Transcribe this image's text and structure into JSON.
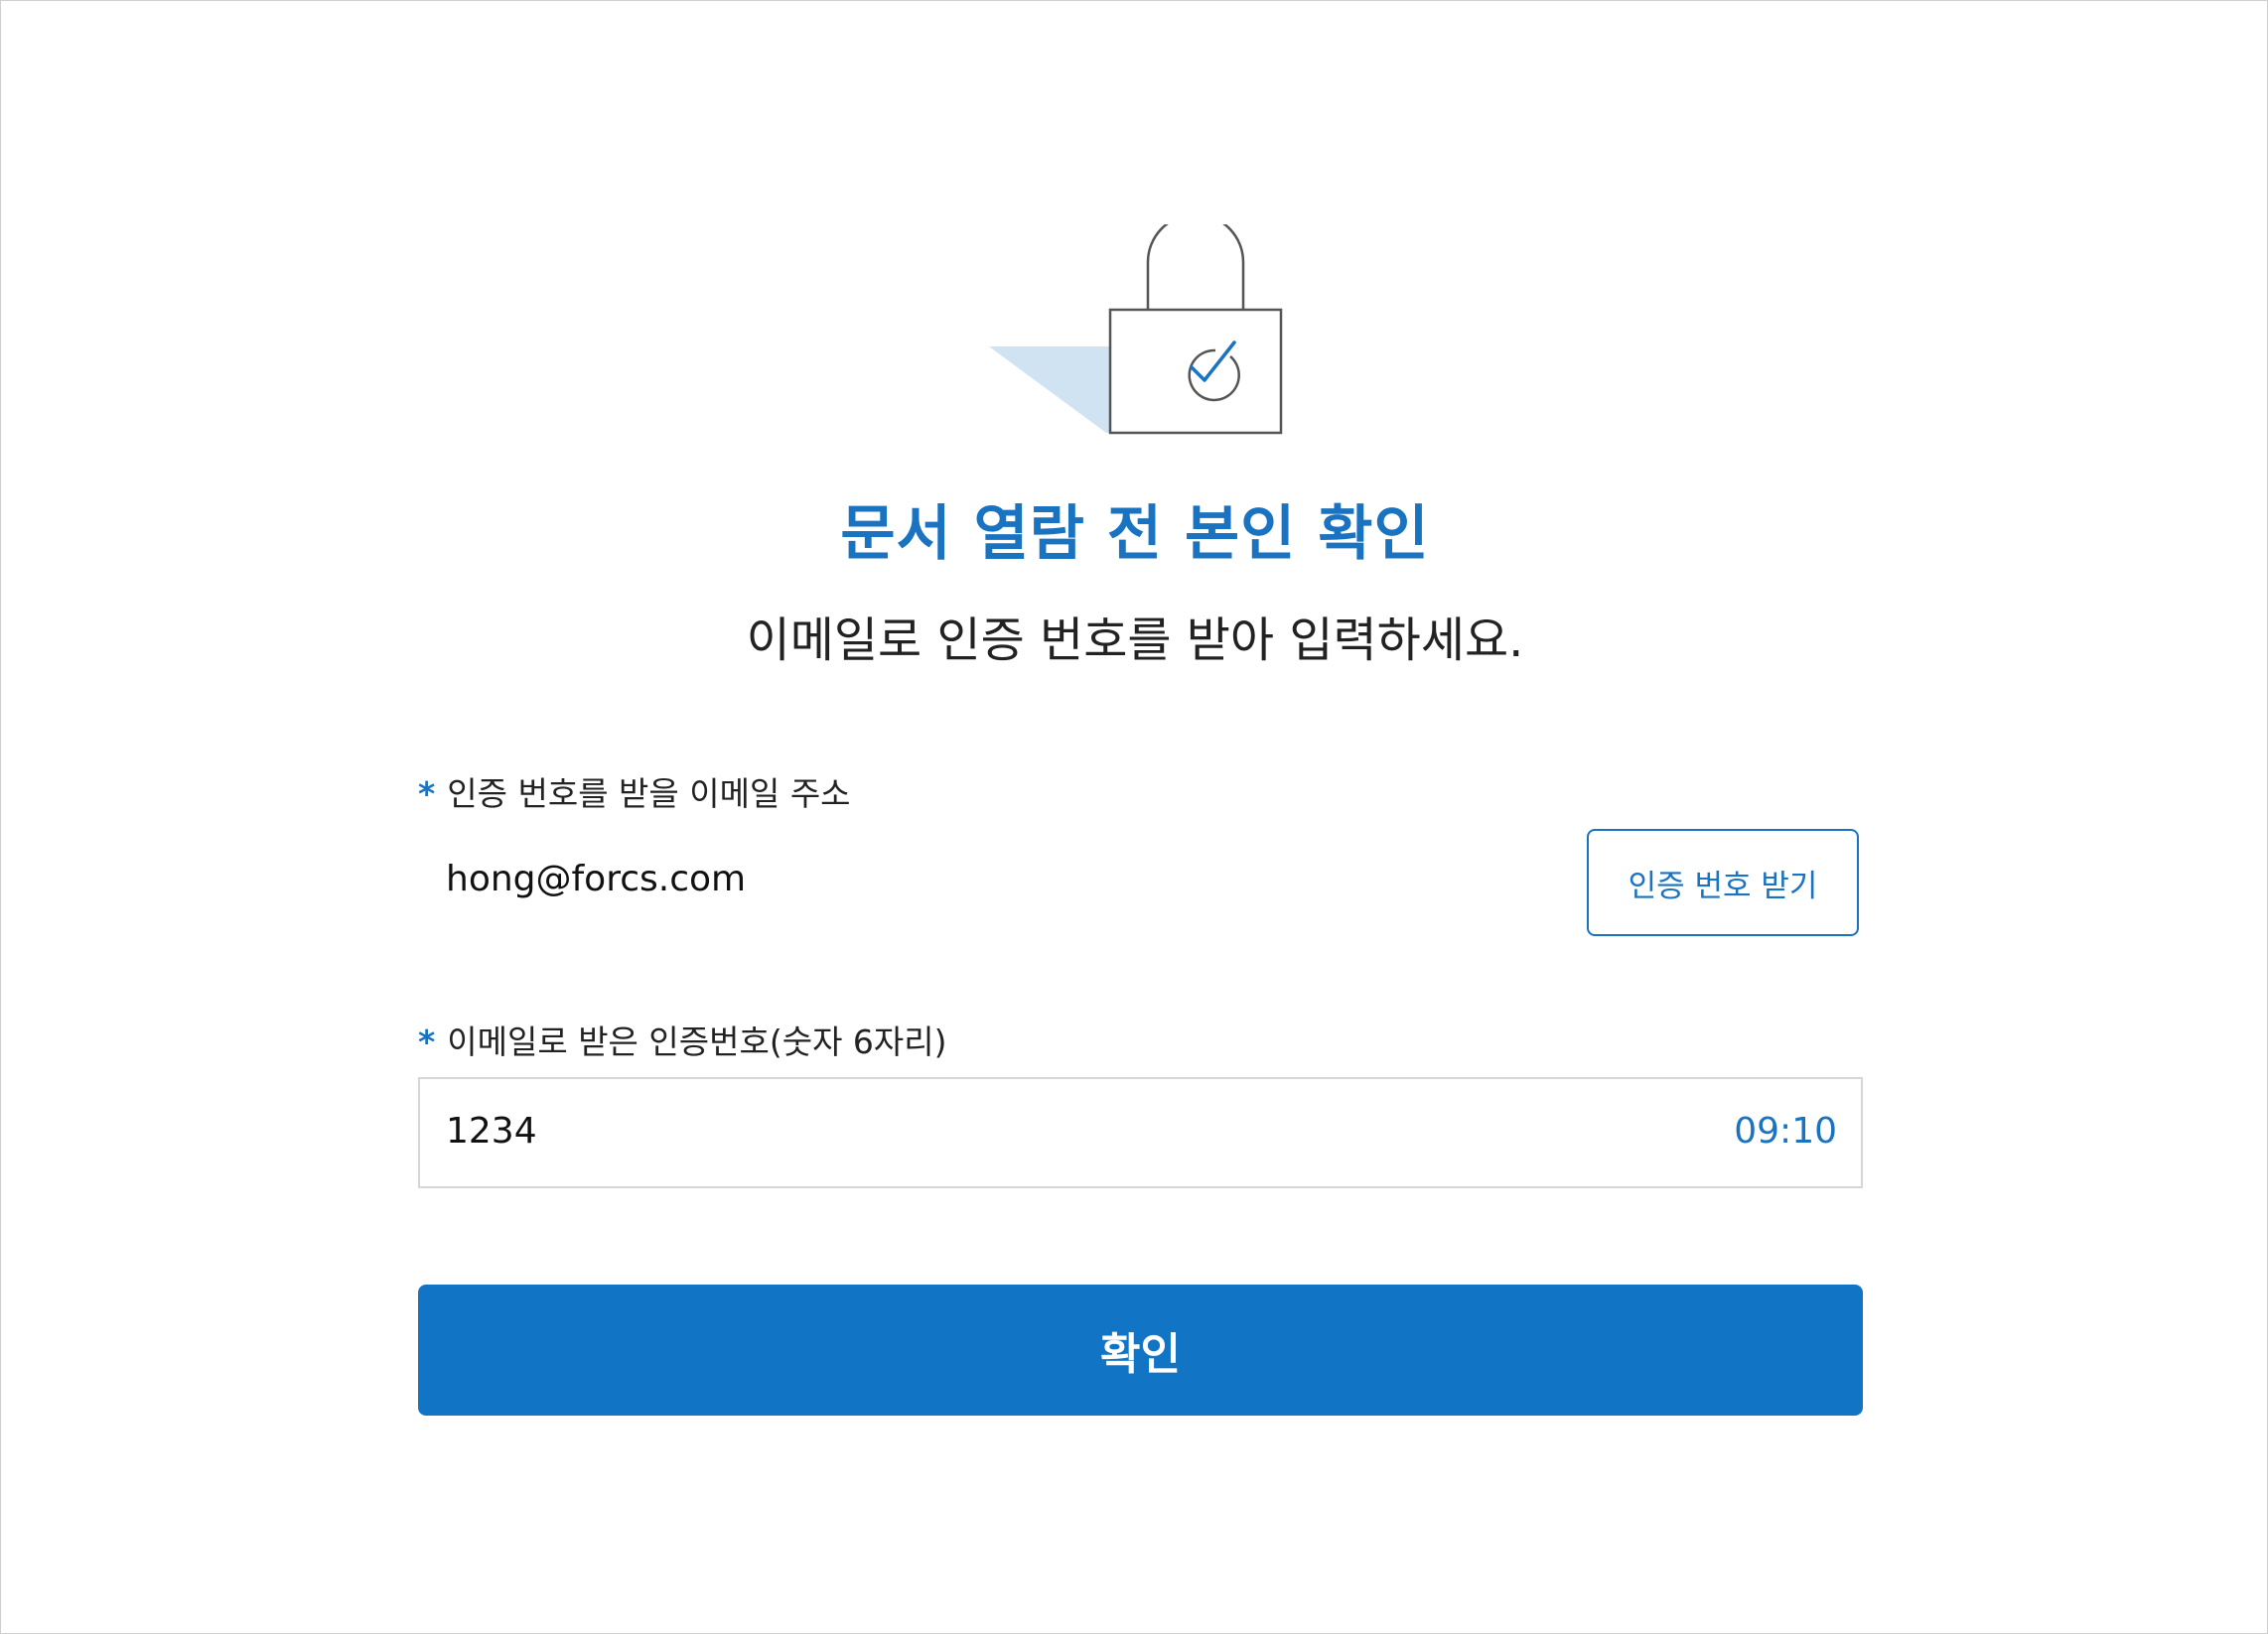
{
  "header": {
    "title": "문서 열람 전 본인 확인",
    "subtitle": "이메일로 인증 번호를 받아 입력하세요."
  },
  "email_field": {
    "required_mark": "*",
    "label": "인증 번호를 받을 이메일 주소",
    "value": "hong@forcs.com",
    "send_button_label": "인증 번호 받기"
  },
  "code_field": {
    "required_mark": "*",
    "label": "이메일로 받은 인증번호(숫자 6자리)",
    "value": "1234",
    "timer": "09:10"
  },
  "confirm_button_label": "확인",
  "icons": {
    "hero": "lock-check-icon"
  },
  "colors": {
    "accent": "#1a73c1",
    "button_bg": "#1274c4",
    "lock_shadow": "#cfe3f3"
  }
}
